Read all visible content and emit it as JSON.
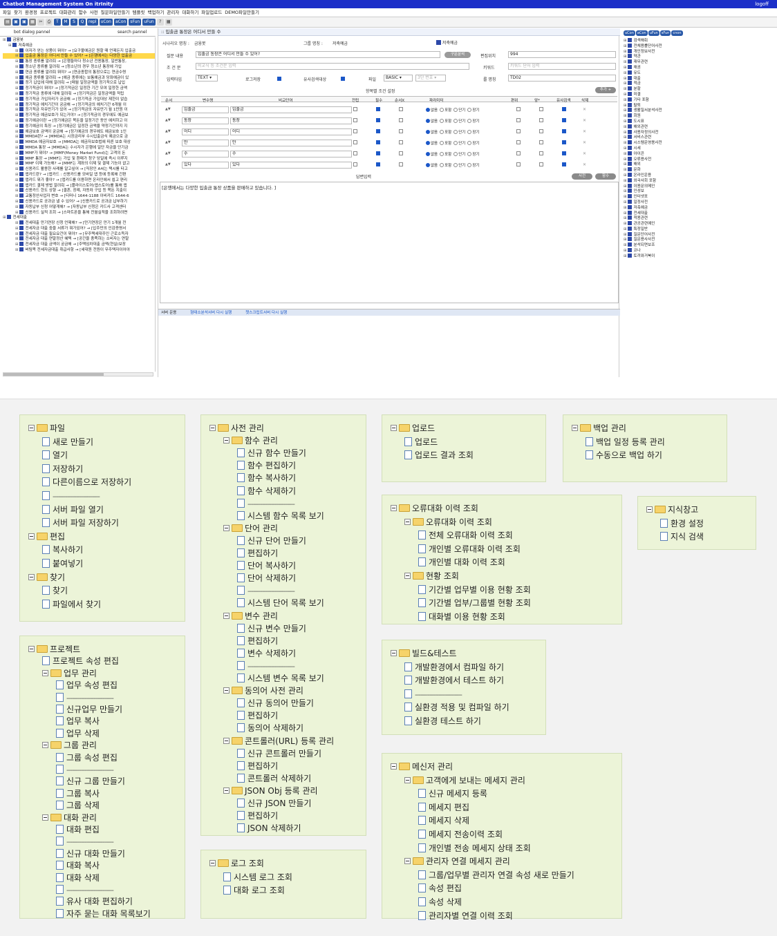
{
  "app": {
    "title": "Chatbot Management System On itrInity",
    "logoff": "logoff"
  },
  "menubar": [
    "파일",
    "찾기",
    "환경정",
    "프로젝트",
    "대화관리",
    "함수",
    "사전",
    "질문파일만들기",
    "템플릿",
    "백업하기",
    "관리자",
    "대화하기",
    "파일업로드",
    "DEMO파일만들기"
  ],
  "toolbar": [
    "T",
    "M",
    "S",
    "Q",
    "repl",
    "uCon",
    "aCon",
    "sFun",
    "uFun"
  ],
  "left_panel": {
    "tabs": [
      "bot dialog pannel",
      "search pannel"
    ],
    "root": "금융봇",
    "group1": "저축예금",
    "items": [
      "이자가 얻는 상품이 뭐야? → [요구불예금은 원할 때 언제든지 입출금",
      "입출금 통장은 어디서 만들 수 있어? → [은행에서는 다양한 입출금",
      "통장 종류를 알려줘 → [은행들마다 청소년 전용통장, 일반통장,",
      "청소년 종류를 알려줘 → [청소년의 경우 청소년 통장에 가입",
      "연금 종류를 알려줘 뭐야? → [연금종합의 통장으로는 연금수령",
      "예금 종류를 알려줘 → [예금 종류에는 보통예금과 당좌예금이 있",
      "정기 납입에 대해 알려줘 → [매월 일정금액을 정기적으로 납입",
      "정기적금이 뭐야? → [정기적금은 일정한 기간 모여 일정한 금액",
      "정기적금 종류에 대해 알려줘 → [정기적금은 일정금액을 적립",
      "정기적금 가입자리가 궁금해 → [정기적금 가입대상 제한이 없습",
      "정기적금 예치기간이 궁금해 → [정기적금의 예치기간 6개월 이",
      "정기적금 자유만기가 있어 → [정기적금의 자유만기 월 1만원 이",
      "정기적금 예금보호가 되는거야? → [정기적금의 경우에도 예금보",
      "정기예금이란 → [정기예금은 목돈을 일정기간 동안 예치하고 이",
      "정기예금의 특징 → [정기예금은 일정한 금액을 약정기간까지 지",
      "예금보호 금액이 궁금해 → [정기예금의 경우에도 예금보호 1인",
      "MMDA란? → [MMDA는 시장금리부 수시입출금식 예금으로 금",
      "MMDA 예금자보호 → [MMDA는 예금자보호법에 따른 보호 대상",
      "MMDA 통장 → [MMDA는 수시자가 은행에 일단 자금을 단기금",
      "MMF가 뭐야? → [MMF(Money Market Fund)는 고객의 돈",
      "MMF 통장 → [MMF는 가입 및 환매가 청구 당일에 즉시 이루지",
      "MMF 이제 가능해? → [MMF는 계좌의 이제 및 결제 기능이 없고",
      "신용카드 활용한 사례를 알고싶어 → [직장인 A씨는 택시를 타고",
      "앱카드란? → [앱카드 : 신용카드를 모바일 앱 등에 등록해 간편",
      "앱카드 뭐가 좋아? → [앱카드를 이용하면 온라인에서 쉽고 편리",
      "앱카드 결제 방법 알려줘 → [플라이스토어(앱스토어)를 통해 앱",
      "신용카드 한도 상향 → [결혼, 장례, 자동차 구입 등 목돈 지출이",
      "교통정산사업자 변호 → [티머니 1644-1188 이비카드 1644-6",
      "신용카드로 공과금 낼 수 있어? → [신용카드로 공과금 납부하기",
      "자동납부 신청 어떻게해? → [자동납부 신청은 카드사 고객센터",
      "신용카드 실적 조회 → [스마트폰을 통해 전월실적을 조회하려면"
    ],
    "group2": "전세대출",
    "items2": [
      "전세대출 만기연장 신청 언제해? → [만기연장은 만기 1개월 전",
      "전세자금 대출 중을 서류가 뭐가있어? → [입주민의 인감증명서",
      "전세자금 대출 필요요건이 뭐야? → [무주택세대주인 근로소득자",
      "전세자금 대출 연말정산 혜택 → [공간을 충족하는 소비자는 연말",
      "전세자금 대출 금액이 궁금해 → [주택임차대출 금액(현실)보장",
      "버팀목 전세자금대출 취급사항 → [세대원 전원이 무주택자이어야"
    ]
  },
  "form": {
    "title": "입출금 통장은 어디서 만들 수",
    "scenario_label": "시나리오 명칭 :",
    "scenario_value": "금융봇",
    "group_label": "그룹 명칭 :",
    "group_value": "저축예금",
    "badge": "저축예금",
    "question_label": "질문 내용",
    "question_value": "입출금 통장은 어디서 만들 수 있어?",
    "analyze_button": "구문분석",
    "position_label": "편집위치",
    "position_value": "994",
    "condition_label": "조 건 문",
    "condition_placeholder": "비교식 등 조건문 입력",
    "keyword_label": "키워드",
    "keyword_placeholder": "키워드 단어 입력",
    "input_type_label": "입력타입",
    "input_type_value": "TEXT",
    "log_label": "로그저장",
    "similar_label": "유사검색대상",
    "file_label": "파일",
    "file_value": "BASIC",
    "num_value": "3단 번호",
    "rule_label": "룰 명칭",
    "rule_value": "TD02",
    "section_title": "항목별 조건 설정",
    "add_button": "추가 +",
    "columns": [
      "순서",
      "변수명",
      "비교단어",
      "전립",
      "필수",
      "순서X",
      "파라미터",
      "편위",
      "앞*",
      "유사검색",
      "삭제"
    ],
    "radio_labels": [
      "없음",
      "포함",
      "단기",
      "장기"
    ],
    "rows": [
      {
        "name": "입출금",
        "word": "입출금"
      },
      {
        "name": "통장",
        "word": "통장"
      },
      {
        "name": "어디",
        "word": "어디"
      },
      {
        "name": "만",
        "word": "만"
      },
      {
        "name": "수",
        "word": "수"
      },
      {
        "name": "있다",
        "word": "있다"
      }
    ],
    "answer_title": "답변입력",
    "dict_button": "사전",
    "func_button": "함수",
    "answer_text": "[은행에서는 다양한 입출금 통장 상품을 판매하고 있습니다. ]"
  },
  "statusbar": {
    "label": "서버 운용",
    "link1": "형태소분석서버 다시 실행",
    "link2": "챗스크립트서버 다시 실행"
  },
  "right_panel": {
    "tabs": [
      "uCon",
      "aCon",
      "uFun",
      "sFun",
      "cnon"
    ],
    "items": [
      "검색해줘",
      "전체용률단어사전",
      "개인정보사전",
      "약관",
      "재무관련",
      "채권",
      "유도",
      "대출",
      "적금",
      "분할",
      "미결",
      "기타 포함",
      "탈퇴",
      "생활질서분석사전",
      "회원",
      "도시표",
      "해외관련",
      "사용자정의사전",
      "서비스관련",
      "시스템운영용사전",
      "시세",
      "아이콘",
      "오류용사전",
      "해외",
      "문화",
      "온라인운용",
      "외국사회 포함",
      "이용문의메인",
      "인성보",
      "인터넷포",
      "일정사전",
      "저축예금",
      "전세대출",
      "적용관련",
      "관공관련예인",
      "특정일반",
      "질문단어사전",
      "질문용사사전",
      "분석되면보조",
      "코나",
      "토끼와거북이"
    ]
  },
  "menus": [
    {
      "id": "file",
      "rows": [
        {
          "l": 0,
          "t": "folder",
          "s": "파일"
        },
        {
          "l": 1,
          "t": "doc",
          "s": "새로 만들기"
        },
        {
          "l": 1,
          "t": "doc",
          "s": "열기"
        },
        {
          "l": 1,
          "t": "doc",
          "s": "저장하기"
        },
        {
          "l": 1,
          "t": "doc",
          "s": "다른이름으로 저장하기"
        },
        {
          "l": 1,
          "t": "sep",
          "s": "--------------------------"
        },
        {
          "l": 1,
          "t": "doc",
          "s": "서버 파일 열기"
        },
        {
          "l": 1,
          "t": "doc",
          "s": "서버 파일 저장하기"
        },
        {
          "l": 0,
          "t": "folder",
          "s": "편집"
        },
        {
          "l": 1,
          "t": "doc",
          "s": "복사하기"
        },
        {
          "l": 1,
          "t": "doc",
          "s": "붙여넣기"
        },
        {
          "l": 0,
          "t": "folder",
          "s": "찾기"
        },
        {
          "l": 1,
          "t": "doc",
          "s": "찾기"
        },
        {
          "l": 1,
          "t": "doc",
          "s": "파일에서 찾기"
        }
      ]
    },
    {
      "id": "project",
      "rows": [
        {
          "l": 0,
          "t": "folder",
          "s": "프로젝트"
        },
        {
          "l": 1,
          "t": "doc",
          "s": "프로젝트 속성 편집"
        },
        {
          "l": 1,
          "t": "folder",
          "s": "업무 관리"
        },
        {
          "l": 2,
          "t": "doc",
          "s": "업무 속성 편집"
        },
        {
          "l": 2,
          "t": "sep",
          "s": "--------------------------"
        },
        {
          "l": 2,
          "t": "doc",
          "s": "신규업무 만들기"
        },
        {
          "l": 2,
          "t": "doc",
          "s": "업무 복사"
        },
        {
          "l": 2,
          "t": "doc",
          "s": "업무 삭제"
        },
        {
          "l": 1,
          "t": "folder",
          "s": "그룹 관리"
        },
        {
          "l": 2,
          "t": "doc",
          "s": "그룹 속성 편집"
        },
        {
          "l": 2,
          "t": "sep",
          "s": "--------------------------"
        },
        {
          "l": 2,
          "t": "doc",
          "s": "신규 그룹 만들기"
        },
        {
          "l": 2,
          "t": "doc",
          "s": "그룹 복사"
        },
        {
          "l": 2,
          "t": "doc",
          "s": "그룹 삭제"
        },
        {
          "l": 1,
          "t": "folder",
          "s": "대화 관리"
        },
        {
          "l": 2,
          "t": "doc",
          "s": "대화 편집"
        },
        {
          "l": 2,
          "t": "sep",
          "s": "--------------------------"
        },
        {
          "l": 2,
          "t": "doc",
          "s": "신규 대화 만들기"
        },
        {
          "l": 2,
          "t": "doc",
          "s": "대화 복사"
        },
        {
          "l": 2,
          "t": "doc",
          "s": "대화 삭제"
        },
        {
          "l": 2,
          "t": "sep",
          "s": "--------------------------"
        },
        {
          "l": 2,
          "t": "doc",
          "s": "유사 대화 편집하기"
        },
        {
          "l": 2,
          "t": "doc",
          "s": "자주 묻는 대화 목록보기"
        }
      ]
    },
    {
      "id": "dict",
      "rows": [
        {
          "l": 0,
          "t": "folder",
          "s": "사전 관리"
        },
        {
          "l": 1,
          "t": "folder",
          "s": "함수 관리"
        },
        {
          "l": 2,
          "t": "doc",
          "s": "신규 함수 만들기"
        },
        {
          "l": 2,
          "t": "doc",
          "s": "함수 편집하기"
        },
        {
          "l": 2,
          "t": "doc",
          "s": "함수 복사하기"
        },
        {
          "l": 2,
          "t": "doc",
          "s": "함수 삭제하기"
        },
        {
          "l": 2,
          "t": "sep",
          "s": "--------------------------"
        },
        {
          "l": 2,
          "t": "doc",
          "s": "시스템 함수 목록 보기"
        },
        {
          "l": 1,
          "t": "folder",
          "s": "단어 관리"
        },
        {
          "l": 2,
          "t": "doc",
          "s": "신규 단어 만들기"
        },
        {
          "l": 2,
          "t": "doc",
          "s": "편집하기"
        },
        {
          "l": 2,
          "t": "doc",
          "s": "단어 복사하기"
        },
        {
          "l": 2,
          "t": "doc",
          "s": "단어 삭제하기"
        },
        {
          "l": 2,
          "t": "sep",
          "s": "--------------------------"
        },
        {
          "l": 2,
          "t": "doc",
          "s": "시스템 단어 목록 보기"
        },
        {
          "l": 1,
          "t": "folder",
          "s": "변수 관리"
        },
        {
          "l": 2,
          "t": "doc",
          "s": "신규 변수 만들기"
        },
        {
          "l": 2,
          "t": "doc",
          "s": "편집하기"
        },
        {
          "l": 2,
          "t": "doc",
          "s": "변수 삭제하기"
        },
        {
          "l": 2,
          "t": "sep",
          "s": "--------------------------"
        },
        {
          "l": 2,
          "t": "doc",
          "s": "시스템 변수 목록 보기"
        },
        {
          "l": 1,
          "t": "folder",
          "s": "동의어 사전 관리"
        },
        {
          "l": 2,
          "t": "doc",
          "s": "신규 동의어 만들기"
        },
        {
          "l": 2,
          "t": "doc",
          "s": "편집하기"
        },
        {
          "l": 2,
          "t": "doc",
          "s": "동의어 삭제하기"
        },
        {
          "l": 1,
          "t": "folder",
          "s": "콘트롤러(URL) 등록 관리"
        },
        {
          "l": 2,
          "t": "doc",
          "s": "신규 콘트롤러 만들기"
        },
        {
          "l": 2,
          "t": "doc",
          "s": "편집하기"
        },
        {
          "l": 2,
          "t": "doc",
          "s": "콘트롤러 삭제하기"
        },
        {
          "l": 1,
          "t": "folder",
          "s": "JSON Obj 등록 관리"
        },
        {
          "l": 2,
          "t": "doc",
          "s": "신규 JSON 만들기"
        },
        {
          "l": 2,
          "t": "doc",
          "s": "편집하기"
        },
        {
          "l": 2,
          "t": "doc",
          "s": "JSON 삭제하기"
        }
      ]
    },
    {
      "id": "log",
      "rows": [
        {
          "l": 0,
          "t": "folder",
          "s": "로그 조회"
        },
        {
          "l": 1,
          "t": "doc",
          "s": "시스템 로그 조회"
        },
        {
          "l": 1,
          "t": "doc",
          "s": "대화 로그 조회"
        }
      ]
    },
    {
      "id": "upload",
      "rows": [
        {
          "l": 0,
          "t": "folder",
          "s": "업로드"
        },
        {
          "l": 1,
          "t": "doc",
          "s": "업로드"
        },
        {
          "l": 1,
          "t": "doc",
          "s": "업로드 결과 조회"
        }
      ]
    },
    {
      "id": "error",
      "rows": [
        {
          "l": 0,
          "t": "folder",
          "s": "오류대화 이력 조회"
        },
        {
          "l": 1,
          "t": "folder",
          "s": "오류대화 이력 조회"
        },
        {
          "l": 2,
          "t": "doc",
          "s": "전체 오류대화 이력 조회"
        },
        {
          "l": 2,
          "t": "doc",
          "s": "개인별 오류대화 이력 조회"
        },
        {
          "l": 2,
          "t": "doc",
          "s": "개인별 대화 이력 조회"
        },
        {
          "l": 1,
          "t": "folder",
          "s": "현황 조회"
        },
        {
          "l": 2,
          "t": "doc",
          "s": "기간별 업무별 이용 현황 조회"
        },
        {
          "l": 2,
          "t": "doc",
          "s": "기간별 업부/그룹별 현황 조회"
        },
        {
          "l": 2,
          "t": "doc",
          "s": "대화별 이용 현황 조회"
        }
      ]
    },
    {
      "id": "build",
      "rows": [
        {
          "l": 0,
          "t": "folder",
          "s": "빌드&테스트"
        },
        {
          "l": 1,
          "t": "doc",
          "s": "개발환경에서 컴파일 하기"
        },
        {
          "l": 1,
          "t": "doc",
          "s": "개발환경에서 테스트 하기"
        },
        {
          "l": 1,
          "t": "sep",
          "s": "--------------------------"
        },
        {
          "l": 1,
          "t": "doc",
          "s": "실환경 적용 및 컴파일 하기"
        },
        {
          "l": 1,
          "t": "doc",
          "s": "실환경 테스트 하기"
        }
      ]
    },
    {
      "id": "messenger",
      "rows": [
        {
          "l": 0,
          "t": "folder",
          "s": "메신저 관리"
        },
        {
          "l": 1,
          "t": "folder",
          "s": "고객에게 보내는 메세지 관리"
        },
        {
          "l": 2,
          "t": "doc",
          "s": "신규 메세지 등록"
        },
        {
          "l": 2,
          "t": "doc",
          "s": "메세지 편집"
        },
        {
          "l": 2,
          "t": "doc",
          "s": "메세지 삭제"
        },
        {
          "l": 2,
          "t": "doc",
          "s": "메세지 전송이력 조회"
        },
        {
          "l": 2,
          "t": "doc",
          "s": "개인별 전송 메세지 상태 조회"
        },
        {
          "l": 1,
          "t": "folder",
          "s": "관리자 연결 메세지 관리"
        },
        {
          "l": 2,
          "t": "doc",
          "s": "그룹/업무별 관리자 연결 속성 새로 만들기"
        },
        {
          "l": 2,
          "t": "doc",
          "s": "속성 편집"
        },
        {
          "l": 2,
          "t": "doc",
          "s": "속성 삭제"
        },
        {
          "l": 2,
          "t": "doc",
          "s": "관리자별 연결 이력 조회"
        }
      ]
    },
    {
      "id": "backup",
      "rows": [
        {
          "l": 0,
          "t": "folder",
          "s": "백업 관리"
        },
        {
          "l": 1,
          "t": "doc",
          "s": "백업 일정 등록 관리"
        },
        {
          "l": 1,
          "t": "doc",
          "s": "수동으로 백업 하기"
        }
      ]
    },
    {
      "id": "knowledge",
      "rows": [
        {
          "l": 0,
          "t": "folder",
          "s": "지식창고"
        },
        {
          "l": 1,
          "t": "doc",
          "s": "환경 설정"
        },
        {
          "l": 1,
          "t": "doc",
          "s": "지식 검색"
        }
      ]
    }
  ]
}
